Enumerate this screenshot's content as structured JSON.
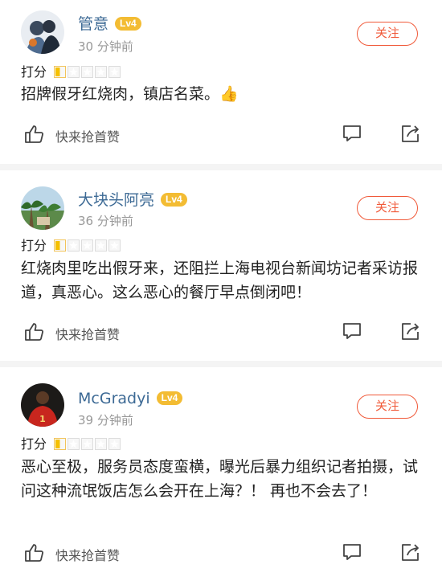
{
  "reviews": [
    {
      "username": "管意",
      "level": "Lv4",
      "time": "30 分钟前",
      "follow_label": "关注",
      "rating_label": "打分",
      "rating": 0.5,
      "content": "招牌假牙红烧肉，镇店名菜。👍",
      "first_like_label": "快来抢首赞"
    },
    {
      "username": "大块头阿亮",
      "level": "Lv4",
      "time": "36 分钟前",
      "follow_label": "关注",
      "rating_label": "打分",
      "rating": 0.5,
      "content": "红烧肉里吃出假牙来，还阻拦上海电视台新闻坊记者采访报道，真恶心。这么恶心的餐厅早点倒闭吧！",
      "first_like_label": "快来抢首赞"
    },
    {
      "username": "McGradyi",
      "level": "Lv4",
      "time": "39 分钟前",
      "follow_label": "关注",
      "rating_label": "打分",
      "rating": 0.5,
      "content": "恶心至极，服务员态度蛮横，曝光后暴力组织记者拍摄，试问这种流氓饭店怎么会开在上海？！ 再也不会去了！",
      "first_like_label": "快来抢首赞"
    }
  ],
  "colors": {
    "username": "#3d6a95",
    "level_badge": "#f3bc33",
    "follow": "#f05a3a",
    "star": "#f5c000"
  },
  "icons": {
    "like": "thumbs-up-icon",
    "comment": "comment-icon",
    "share": "share-icon"
  }
}
